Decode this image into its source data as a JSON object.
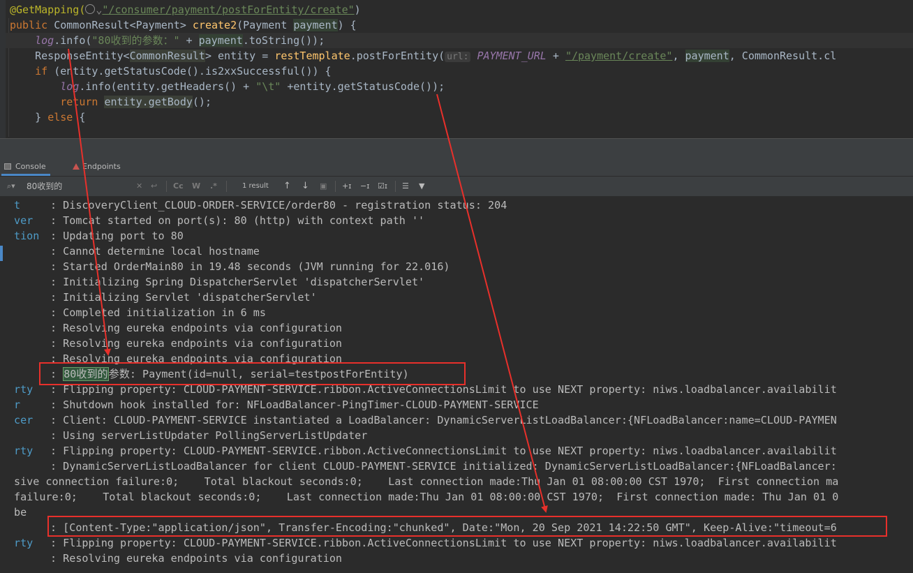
{
  "editor": {
    "lines": [
      {
        "annotation": "@GetMapping(",
        "globe": "",
        "url": "\"/consumer/payment/postForEntity/create\"",
        "close": ")"
      },
      {
        "kw": "public ",
        "type": "CommonResult<Payment> ",
        "method": "create2",
        "rest": "(Payment ",
        "param": "payment",
        ") {": ") {"
      },
      {
        "log": "log",
        "a": ".info(",
        "s": "\"80收到的参数：\"",
        "b": " + ",
        "param": "payment",
        ".toString());": ".toString());"
      },
      {
        "t": "ResponseEntity<",
        "th": "CommonResult",
        "t2": "> entity = ",
        "m": "restTemplate",
        "t3": ".postForEntity(",
        "hint": "url:",
        "const": " PAYMENT_URL",
        " + ": " + ",
        "s": "\"/payment/create\"",
        ", ": ", ",
        "p": "payment",
        ", C": ", CommonResult.cl"
      },
      {
        "kw": "if ",
        "rest": "(entity.getStatusCode().is2xxSuccessful()) {"
      },
      {
        "log": "log",
        "a": ".info(entity.getHeaders() + ",
        "s": "\"\\t\"",
        "b": " +entity.getStatusCode());"
      },
      {
        "kw": "return ",
        "hl": "entity.getBody",
        "rest": "();"
      },
      {
        "a": "} ",
        "kw": "else",
        "b": " {"
      }
    ]
  },
  "tabs": {
    "console": "Console",
    "endpoints": "Endpoints"
  },
  "search": {
    "query": "80收到的",
    "match_case": "Cc",
    "words": "W",
    "regex": ".*",
    "result_count": "1 result"
  },
  "console": {
    "rows": [
      {
        "src": "t",
        "msg": ": DiscoveryClient_CLOUD-ORDER-SERVICE/order80 - registration status: 204"
      },
      {
        "src": "ver",
        "msg": ": Tomcat started on port(s): 80 (http) with context path ''"
      },
      {
        "src": "tion",
        "msg": ": Updating port to 80"
      },
      {
        "src": "",
        "msg": ": Cannot determine local hostname"
      },
      {
        "src": "",
        "msg": ": Started OrderMain80 in 19.48 seconds (JVM running for 22.016)"
      },
      {
        "src": "",
        "msg": ": Initializing Spring DispatcherServlet 'dispatcherServlet'"
      },
      {
        "src": "",
        "msg": ": Initializing Servlet 'dispatcherServlet'"
      },
      {
        "src": "",
        "msg": ": Completed initialization in 6 ms"
      },
      {
        "src": "",
        "msg": ": Resolving eureka endpoints via configuration"
      },
      {
        "src": "",
        "msg": ": Resolving eureka endpoints via configuration"
      },
      {
        "src": "",
        "msg": ": Resolving eureka endpoints via configuration"
      },
      {
        "src": "",
        "pre": ": ",
        "match": "80收到的",
        "msg": "参数: Payment(id=null, serial=testpostForEntity)"
      },
      {
        "src": "rty",
        "msg": ": Flipping property: CLOUD-PAYMENT-SERVICE.ribbon.ActiveConnectionsLimit to use NEXT property: niws.loadbalancer.availabilit"
      },
      {
        "src": "r",
        "msg": ": Shutdown hook installed for: NFLoadBalancer-PingTimer-CLOUD-PAYMENT-SERVICE"
      },
      {
        "src": "cer",
        "msg": ": Client: CLOUD-PAYMENT-SERVICE instantiated a LoadBalancer: DynamicServerListLoadBalancer:{NFLoadBalancer:name=CLOUD-PAYMEN"
      },
      {
        "src": "",
        "msg": ": Using serverListUpdater PollingServerListUpdater"
      },
      {
        "src": "rty",
        "msg": ": Flipping property: CLOUD-PAYMENT-SERVICE.ribbon.ActiveConnectionsLimit to use NEXT property: niws.loadbalancer.availabilit"
      },
      {
        "src": "",
        "msg": ": DynamicServerListLoadBalancer for client CLOUD-PAYMENT-SERVICE initialized: DynamicServerListLoadBalancer:{NFLoadBalancer:"
      },
      {
        "full": "sive connection failure:0;    Total blackout seconds:0;    Last connection made:Thu Jan 01 08:00:00 CST 1970;  First connection ma"
      },
      {
        "full": "failure:0;    Total blackout seconds:0;    Last connection made:Thu Jan 01 08:00:00 CST 1970;  First connection made: Thu Jan 01 0"
      },
      {
        "full": "be"
      },
      {
        "src": "",
        "msg": ": [Content-Type:\"application/json\", Transfer-Encoding:\"chunked\", Date:\"Mon, 20 Sep 2021 14:22:50 GMT\", Keep-Alive:\"timeout=6"
      },
      {
        "src": "rty",
        "msg": ": Flipping property: CLOUD-PAYMENT-SERVICE.ribbon.ActiveConnectionsLimit to use NEXT property: niws.loadbalancer.availabilit"
      },
      {
        "src": "",
        "msg": ": Resolving eureka endpoints via configuration"
      }
    ]
  },
  "colors": {
    "annotation": "#e8302b",
    "source": "#4e9bc7",
    "console_text": "#bbbbbb",
    "background": "#2b2b2b"
  }
}
